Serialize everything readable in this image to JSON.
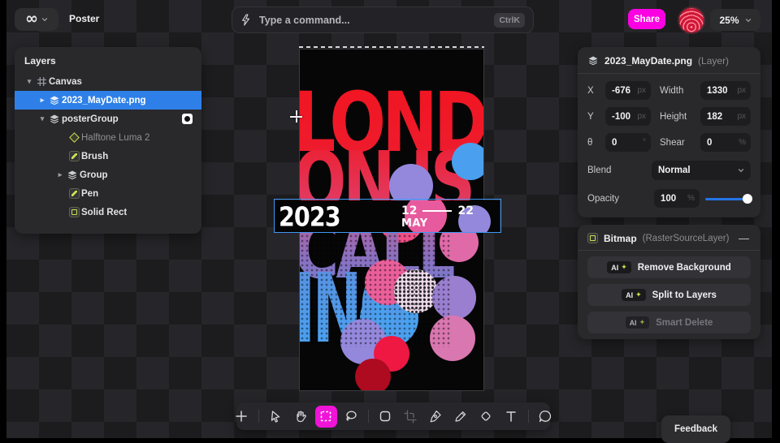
{
  "topbar": {
    "logo_glyph": "∞",
    "document_title": "Poster",
    "command_bar": {
      "placeholder": "Type a command...",
      "shortcut": "CtrlK"
    },
    "share_label": "Share",
    "zoom_level": "25%"
  },
  "layers_panel": {
    "title": "Layers",
    "tree": [
      {
        "label": "Canvas",
        "icon": "canvas-grid-icon",
        "depth": 0,
        "expanded": true
      },
      {
        "label": "2023_MayDate.png",
        "icon": "layer-stack-icon",
        "depth": 1,
        "collapsed": true,
        "selected": true
      },
      {
        "label": "posterGroup",
        "icon": "layer-stack-icon",
        "depth": 1,
        "expanded": true,
        "mask_badge": true
      },
      {
        "label": "Halftone Luma 2",
        "icon": "effect-diamond-icon",
        "depth": 2,
        "dimmed": true
      },
      {
        "label": "Brush",
        "icon": "brush-tile-icon",
        "depth": 2
      },
      {
        "label": "Group",
        "icon": "layer-stack-icon",
        "depth": 2,
        "collapsed": true
      },
      {
        "label": "Pen",
        "icon": "pen-tile-icon",
        "depth": 2
      },
      {
        "label": "Solid Rect",
        "icon": "rect-tile-icon",
        "depth": 2
      }
    ]
  },
  "inspector": {
    "header": {
      "name": "2023_MayDate.png",
      "type": "(Layer)"
    },
    "fields": [
      {
        "label": "X",
        "value": "-676",
        "unit": "px"
      },
      {
        "label": "Width",
        "value": "1330",
        "unit": "px"
      },
      {
        "label": "Y",
        "value": "-100",
        "unit": "px"
      },
      {
        "label": "Height",
        "value": "182",
        "unit": "px"
      },
      {
        "label": "θ",
        "value": "0",
        "unit": "°"
      },
      {
        "label": "Shear",
        "value": "0",
        "unit": "%"
      }
    ],
    "blend": {
      "label": "Blend",
      "value": "Normal"
    },
    "opacity": {
      "label": "Opacity",
      "value": "100",
      "unit": "%"
    }
  },
  "bitmap_panel": {
    "title": "Bitmap",
    "subtitle": "(RasterSourceLayer)",
    "collapse_glyph": "—",
    "badge_text": "AI",
    "badge_star": "✦",
    "actions": [
      {
        "label": "Remove Background",
        "enabled": true
      },
      {
        "label": "Split to Layers",
        "enabled": true
      },
      {
        "label": "Smart Delete",
        "enabled": false
      }
    ]
  },
  "toolbar": {
    "active_tool": "marquee",
    "tools": [
      "add",
      "select",
      "pan",
      "marquee",
      "lasso",
      "frame",
      "crop",
      "pen",
      "pencil",
      "eraser",
      "text",
      "comment"
    ]
  },
  "canvas": {
    "poster": {
      "line1": "LOND",
      "line2": "ON IS",
      "line3": "CALL",
      "line4": "ING",
      "year": "2023",
      "date_start": "12",
      "date_end": "22",
      "month": "MAY"
    }
  },
  "feedback_label": "Feedback",
  "colors": {
    "accent_blue": "#2e80e8",
    "magenta": "#f013d8",
    "share_pink": "#fb00e2",
    "slider_blue": "#2574e8",
    "ai_star_green": "#cde04e",
    "poster_red": "#ee1a29",
    "poster_blue": "#47a4f2"
  }
}
